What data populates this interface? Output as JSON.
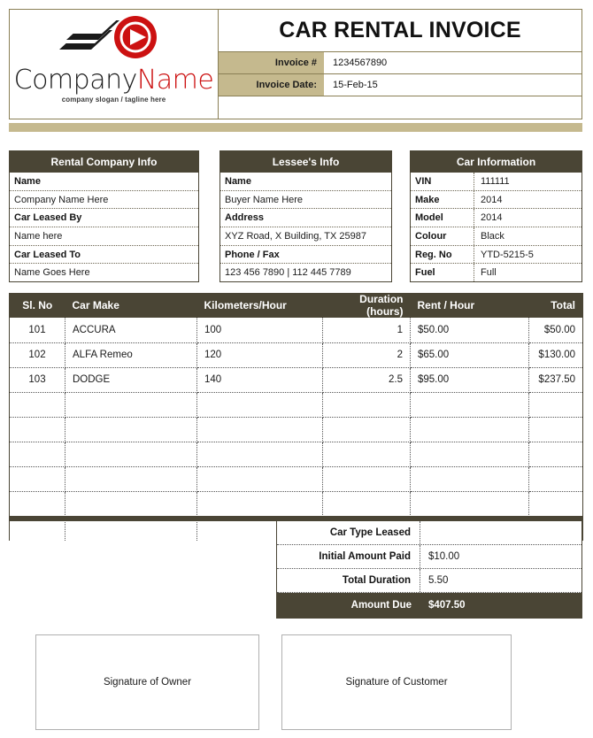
{
  "header": {
    "title": "CAR RENTAL INVOICE",
    "logo": {
      "icon": "play-button-logo-icon",
      "name_part1": "Company",
      "name_part2": "Name",
      "tagline": "company slogan / tagline here"
    },
    "fields": [
      {
        "label": "Invoice #",
        "value": "1234567890"
      },
      {
        "label": "Invoice Date:",
        "value": "15-Feb-15"
      }
    ]
  },
  "info_boxes": {
    "rental_company": {
      "title": "Rental Company Info",
      "lines": [
        {
          "type": "label",
          "text": "Name"
        },
        {
          "type": "value",
          "text": "Company Name Here"
        },
        {
          "type": "label",
          "text": "Car Leased By"
        },
        {
          "type": "value",
          "text": "Name here"
        },
        {
          "type": "label",
          "text": "Car Leased To"
        },
        {
          "type": "value",
          "text": "Name Goes Here"
        }
      ]
    },
    "lessee": {
      "title": "Lessee's Info",
      "lines": [
        {
          "type": "label",
          "text": "Name"
        },
        {
          "type": "value",
          "text": "Buyer Name Here"
        },
        {
          "type": "label",
          "text": "Address"
        },
        {
          "type": "value",
          "text": "XYZ Road, X Building, TX 25987"
        },
        {
          "type": "label",
          "text": "Phone / Fax"
        },
        {
          "type": "value",
          "text": "123 456 7890 | 112 445 7789"
        }
      ]
    },
    "car_information": {
      "title": "Car Information",
      "rows": [
        {
          "key": "VIN",
          "value": "111111"
        },
        {
          "key": "Make",
          "value": "2014"
        },
        {
          "key": "Model",
          "value": "2014"
        },
        {
          "key": "Colour",
          "value": "Black"
        },
        {
          "key": "Reg. No",
          "value": "YTD-5215-5"
        },
        {
          "key": "Fuel",
          "value": "Full"
        }
      ]
    }
  },
  "line_items": {
    "columns": [
      "Sl. No",
      "Car Make",
      "Kilometers/Hour",
      "Duration (hours)",
      "Rent / Hour",
      "Total"
    ],
    "rows": [
      {
        "sl_no": "101",
        "car_make": "ACCURA",
        "kmph": "100",
        "duration": "1",
        "rent": "$50.00",
        "total": "$50.00"
      },
      {
        "sl_no": "102",
        "car_make": "ALFA Remeo",
        "kmph": "120",
        "duration": "2",
        "rent": "$65.00",
        "total": "$130.00"
      },
      {
        "sl_no": "103",
        "car_make": "DODGE",
        "kmph": "140",
        "duration": "2.5",
        "rent": "$95.00",
        "total": "$237.50"
      }
    ],
    "empty_row_count": 6
  },
  "totals": [
    {
      "label": "Car Type Leased",
      "value": ""
    },
    {
      "label": "Initial Amount Paid",
      "value": "$10.00"
    },
    {
      "label": "Total Duration",
      "value": "5.50"
    },
    {
      "label": "Amount Due",
      "value": "$407.50",
      "emphasis": true
    }
  ],
  "signatures": [
    {
      "label": "Signature of Owner"
    },
    {
      "label": "Signature of Customer"
    }
  ],
  "colors": {
    "dark_olive": "#4A4535",
    "tan": "#C5B98E",
    "logo_red": "#CC1111",
    "border_olive": "#8A7F55"
  }
}
